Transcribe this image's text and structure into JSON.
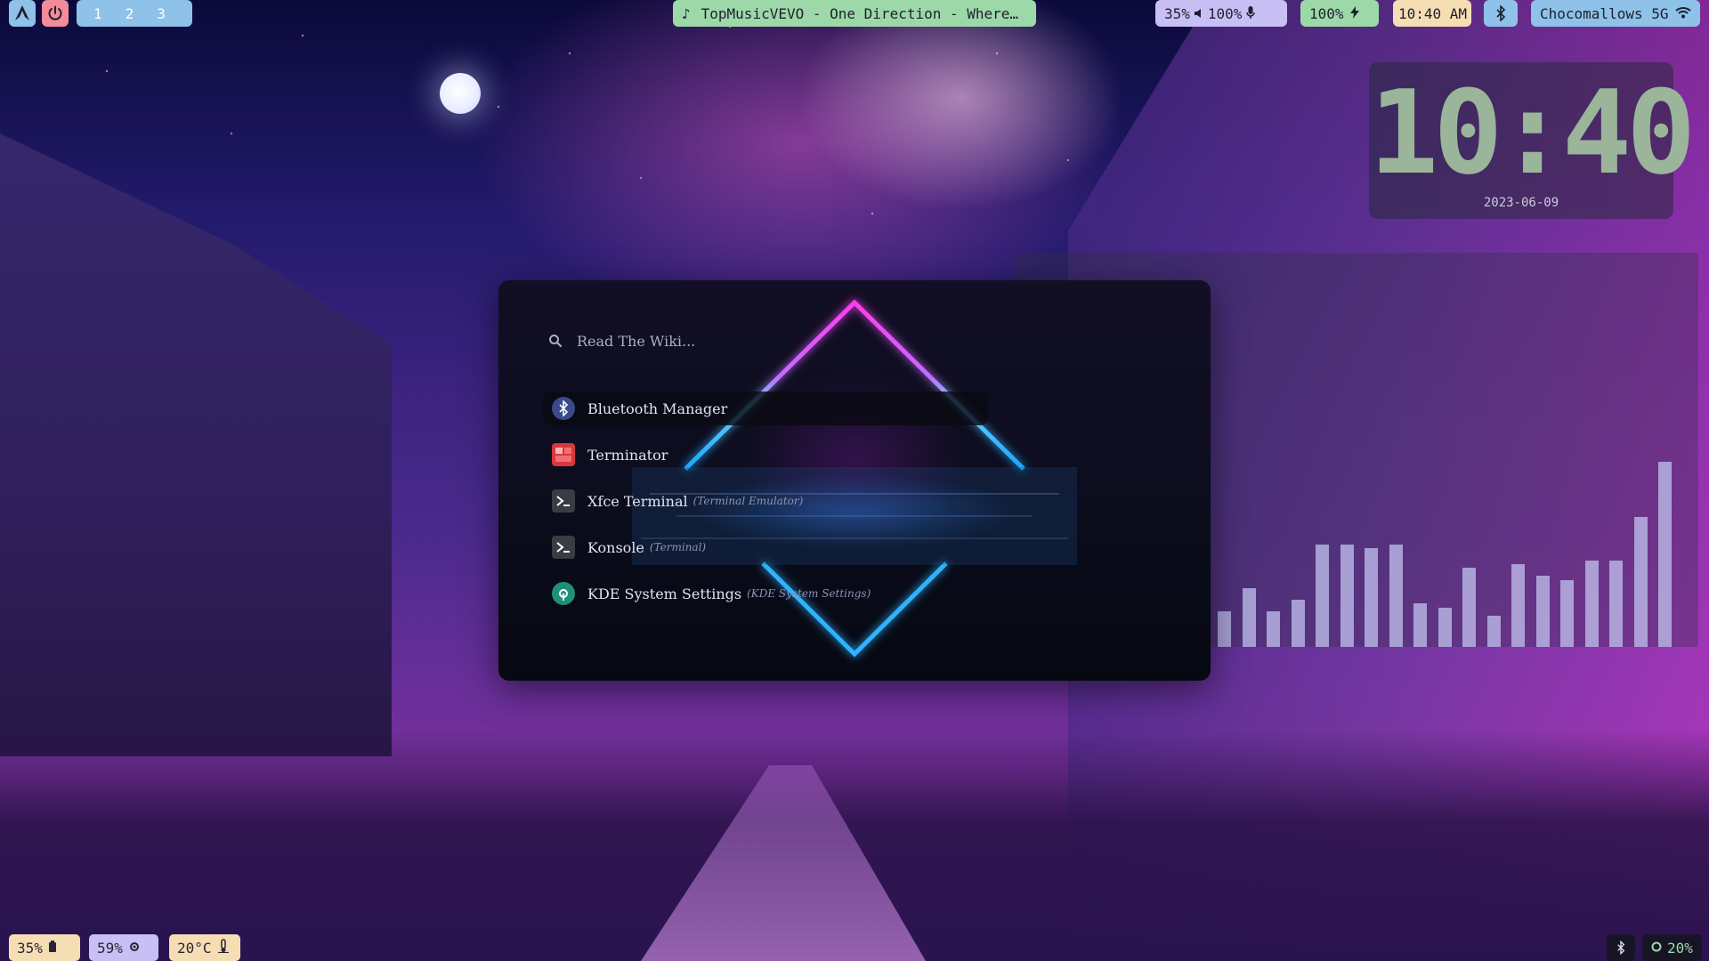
{
  "topbar": {
    "launcher_icon": "arch-icon",
    "power_icon": "power-icon",
    "workspaces": [
      "1",
      "2",
      "3"
    ],
    "media": {
      "icon": "music-note-icon",
      "text": "TopMusicVEVO - One Direction - Where…"
    },
    "audio": {
      "mic_level": "35%",
      "volume_icon": "volume-icon",
      "volume": "100%",
      "mic_icon": "microphone-icon"
    },
    "battery": {
      "value": "100%",
      "icon": "charging-icon"
    },
    "time": "10:40 AM",
    "bluetooth_icon": "bluetooth-icon",
    "network": {
      "ssid": "Chocomallows 5G",
      "icon": "wifi-icon"
    }
  },
  "clock_widget": {
    "time": "10:40",
    "date": "2023-06-09"
  },
  "launcher": {
    "search_placeholder": "Read The Wiki...",
    "search_icon": "search-icon",
    "items": [
      {
        "name": "Bluetooth Manager",
        "sub": "",
        "icon": "bluetooth-icon"
      },
      {
        "name": "Terminator",
        "sub": "",
        "icon": "terminator-icon"
      },
      {
        "name": "Xfce Terminal",
        "sub": "(Terminal Emulator)",
        "icon": "terminal-icon"
      },
      {
        "name": "Konsole",
        "sub": "(Terminal)",
        "icon": "terminal-icon"
      },
      {
        "name": "KDE System Settings",
        "sub": "(KDE System Settings)",
        "icon": "settings-icon"
      }
    ]
  },
  "visualizer": {
    "levels": [
      0.09,
      0.15,
      0.09,
      0.12,
      0.26,
      0.26,
      0.25,
      0.26,
      0.11,
      0.1,
      0.2,
      0.08,
      0.21,
      0.18,
      0.17,
      0.22,
      0.22,
      0.33,
      0.47
    ]
  },
  "bottombar": {
    "battery": {
      "value": "35%",
      "icon": "battery-icon"
    },
    "cpu": {
      "value": "59%",
      "icon": "cpu-icon"
    },
    "temp": {
      "value": "20°C",
      "icon": "thermometer-icon"
    },
    "bluetooth_icon": "bluetooth-icon",
    "brightness": {
      "value": "20%",
      "icon": "brightness-icon"
    }
  },
  "colors": {
    "accent_blue": "#8ec2e8",
    "accent_red": "#f28b9a",
    "accent_green": "#9dd9a8",
    "accent_cream": "#f5deb3",
    "accent_lavender": "#c8c0f5"
  }
}
